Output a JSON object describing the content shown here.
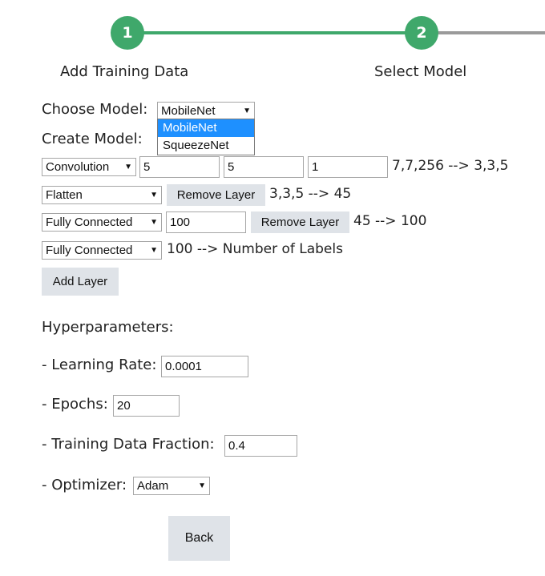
{
  "stepper": {
    "steps": [
      {
        "number": "1",
        "label": "Add Training Data"
      },
      {
        "number": "2",
        "label": "Select Model"
      }
    ],
    "completed_color": "#3fa86b",
    "pending_color": "#9a9a9a"
  },
  "choose_model": {
    "label": "Choose Model:",
    "selected": "MobileNet",
    "options": [
      "MobileNet",
      "SqueezeNet"
    ],
    "highlighted_option": "MobileNet"
  },
  "create_model": {
    "label": "Create Model:",
    "layers": [
      {
        "type": "Convolution",
        "params": [
          "5",
          "5",
          "1"
        ],
        "shape": "7,7,256 --> 3,3,5"
      },
      {
        "type": "Flatten",
        "remove_label": "Remove Layer",
        "shape": "3,3,5 --> 45"
      },
      {
        "type": "Fully Connected",
        "params": [
          "100"
        ],
        "remove_label": "Remove Layer",
        "shape": "45 --> 100"
      },
      {
        "type": "Fully Connected",
        "shape": "100 --> Number of Labels"
      }
    ],
    "add_layer_label": "Add Layer"
  },
  "hyperparameters": {
    "title": "Hyperparameters:",
    "learning_rate": {
      "label": "- Learning Rate:",
      "value": "0.0001"
    },
    "epochs": {
      "label": "- Epochs:",
      "value": "20"
    },
    "training_fraction": {
      "label": "- Training Data Fraction:",
      "value": "0.4"
    },
    "optimizer": {
      "label": "- Optimizer:",
      "value": "Adam"
    }
  },
  "back_label": "Back",
  "icons": {
    "dropdown_arrow": "▼"
  },
  "accent_color": "#1e90ff"
}
